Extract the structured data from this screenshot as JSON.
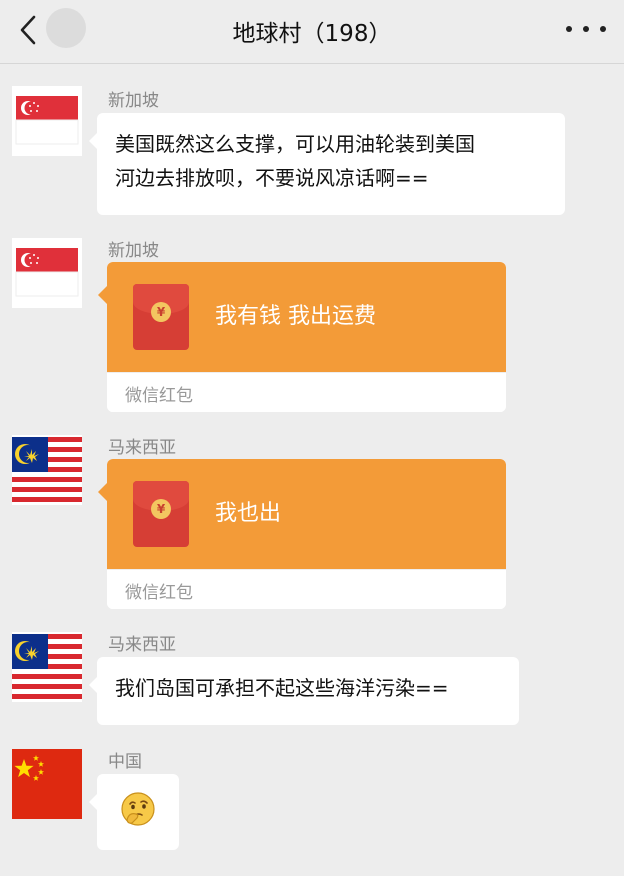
{
  "header": {
    "title": "地球村（198）"
  },
  "messages": [
    {
      "sender": "新加坡",
      "text_line1": "美国既然这么支撑，可以用油轮装到美国",
      "text_line2": "河边去排放呗，不要说风凉话啊=="
    },
    {
      "sender": "新加坡",
      "packet_text": "我有钱 我出运费",
      "packet_label": "微信红包"
    },
    {
      "sender": "马来西亚",
      "packet_text": "我也出",
      "packet_label": "微信红包"
    },
    {
      "sender": "马来西亚",
      "text": "我们岛国可承担不起这些海洋污染=="
    },
    {
      "sender": "中国",
      "emoji": "thinking-face-emoji"
    }
  ],
  "icons": {
    "back": "chevron-left-icon",
    "more": "more-dots-icon",
    "coin": "¥"
  },
  "colors": {
    "background": "#ededed",
    "redpacket_orange": "#f39b38",
    "redpacket_envelope": "#d63e35"
  }
}
